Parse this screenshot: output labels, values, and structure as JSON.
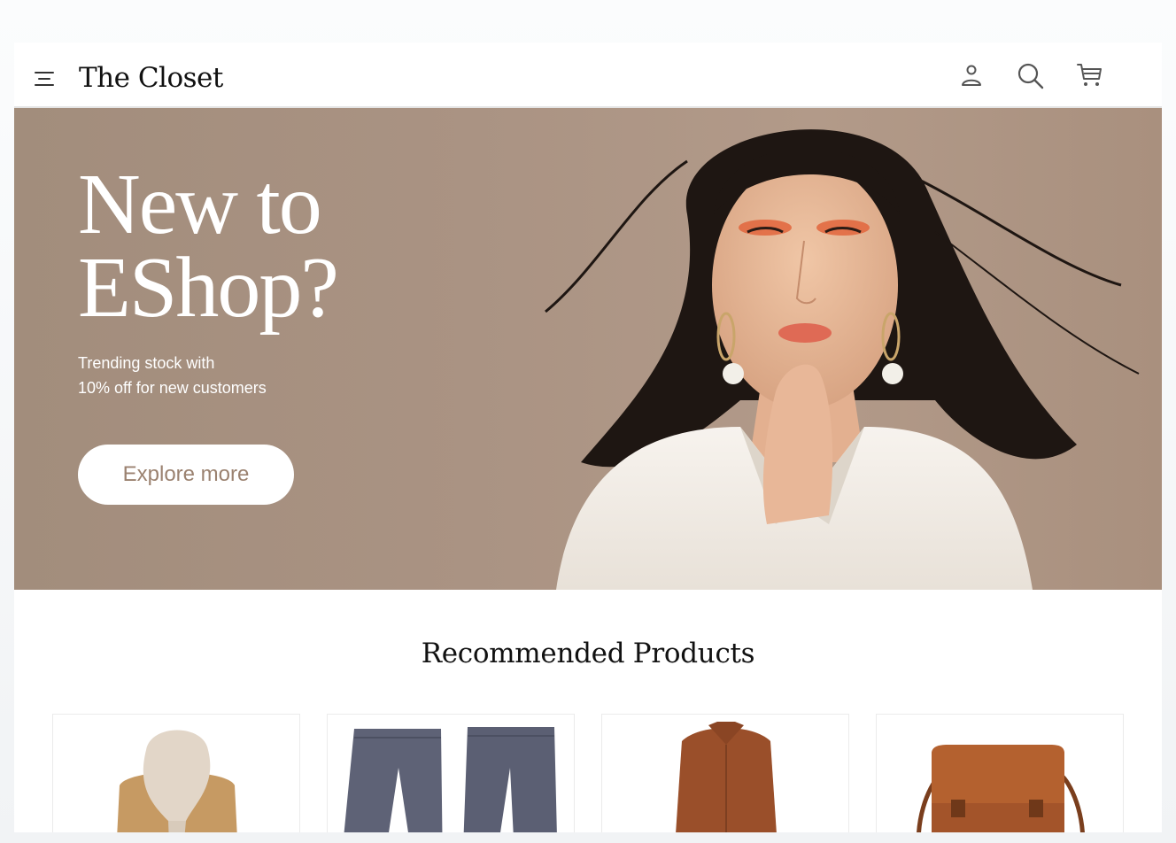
{
  "header": {
    "brand": "The Closet",
    "icons": [
      "menu-icon",
      "user-icon",
      "search-icon",
      "cart-icon"
    ]
  },
  "hero": {
    "title_line1": "New to",
    "title_line2": "EShop?",
    "subtitle_line1": "Trending stock with",
    "subtitle_line2": "10% off for new customers",
    "cta_label": "Explore more"
  },
  "recommended": {
    "title": "Recommended Products",
    "products": [
      {
        "image": "scarf-coat-image"
      },
      {
        "image": "trousers-image"
      },
      {
        "image": "shirt-image"
      },
      {
        "image": "bag-image"
      }
    ]
  },
  "colors": {
    "hero_bg": "#a89281",
    "cta_text": "#9b8270",
    "page_bg": "#f5f7f9"
  }
}
